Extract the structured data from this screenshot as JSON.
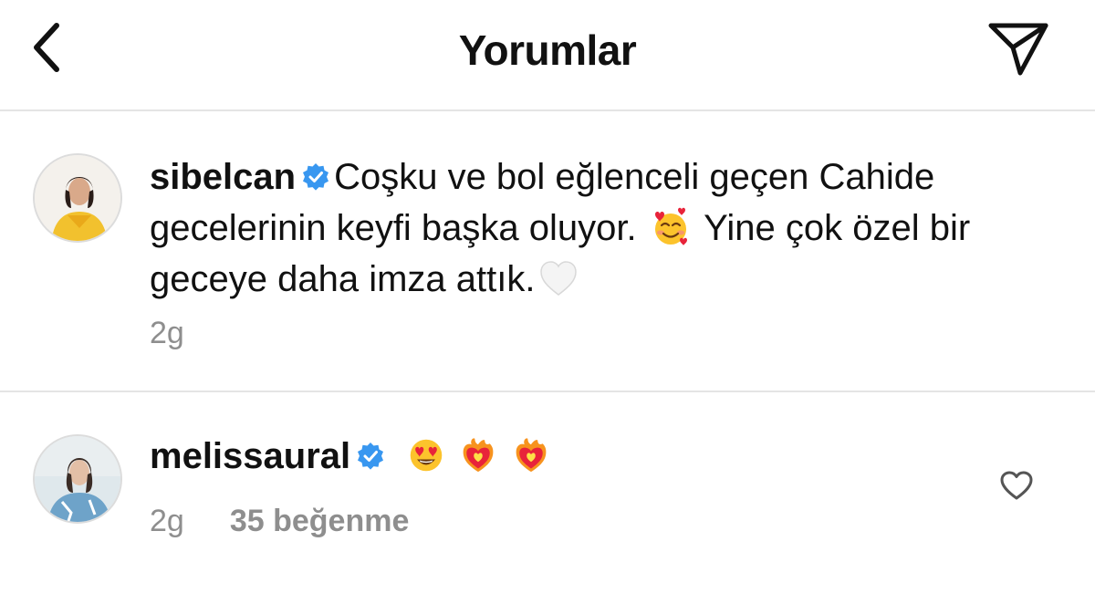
{
  "header": {
    "title": "Yorumlar",
    "back_icon": "chevron-left-icon",
    "send_icon": "paper-plane-icon"
  },
  "caption": {
    "username": "sibelcan",
    "verified": true,
    "text_part1": "Coşku ve bol eğlenceli geçen Cahide gecelerinin keyfi başka oluyor.",
    "emoji1": "smiling-face-with-hearts",
    "text_part2": "Yine çok özel bir geceye daha imza attık.",
    "emoji2": "white-heart",
    "time": "2g"
  },
  "comment": {
    "username": "melissaural",
    "verified": true,
    "emojis": [
      "heart-eyes",
      "heart-on-fire",
      "heart-on-fire"
    ],
    "time": "2g",
    "likes": "35 beğenme",
    "like_icon": "heart-outline-icon"
  },
  "colors": {
    "verified_blue": "#3897f0",
    "muted_text": "#8e8e8e",
    "divider": "#e4e4e4"
  }
}
